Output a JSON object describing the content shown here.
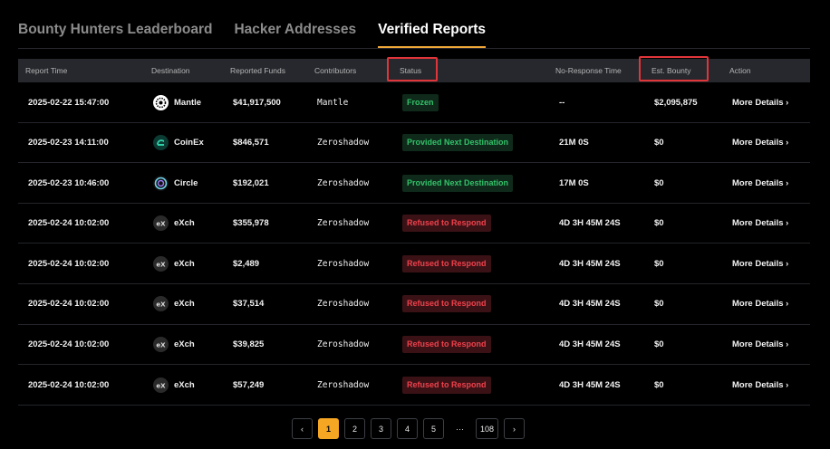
{
  "tabs": [
    "Bounty Hunters Leaderboard",
    "Hacker Addresses",
    "Verified Reports"
  ],
  "headers": {
    "report_time": "Report Time",
    "destination": "Destination",
    "reported_funds": "Reported Funds",
    "contributors": "Contributors",
    "status": "Status",
    "no_response_time": "No-Response Time",
    "est_bounty": "Est. Bounty",
    "action": "Action"
  },
  "highlight_color": "#e0353a",
  "accent_color": "#f5a623",
  "rows": [
    {
      "time": "2025-02-22 15:47:00",
      "dest": "Mantle",
      "dest_icon": "mantle-icon",
      "funds": "$41,917,500",
      "contrib": "Mantle",
      "status": "Frozen",
      "status_color": "green",
      "noresp": "--",
      "bounty": "$2,095,875",
      "action": "More Details ›"
    },
    {
      "time": "2025-02-23 14:11:00",
      "dest": "CoinEx",
      "dest_icon": "coinex-icon",
      "funds": "$846,571",
      "contrib": "Zeroshadow",
      "status": "Provided Next Destination",
      "status_color": "green",
      "noresp": "21M 0S",
      "bounty": "$0",
      "action": "More Details ›"
    },
    {
      "time": "2025-02-23 10:46:00",
      "dest": "Circle",
      "dest_icon": "circle-icon",
      "funds": "$192,021",
      "contrib": "Zeroshadow",
      "status": "Provided Next Destination",
      "status_color": "green",
      "noresp": "17M 0S",
      "bounty": "$0",
      "action": "More Details ›"
    },
    {
      "time": "2025-02-24 10:02:00",
      "dest": "eXch",
      "dest_icon": "exch-icon",
      "funds": "$355,978",
      "contrib": "Zeroshadow",
      "status": "Refused to Respond",
      "status_color": "red",
      "noresp": "4D 3H 45M 24S",
      "bounty": "$0",
      "action": "More Details ›"
    },
    {
      "time": "2025-02-24 10:02:00",
      "dest": "eXch",
      "dest_icon": "exch-icon",
      "funds": "$2,489",
      "contrib": "Zeroshadow",
      "status": "Refused to Respond",
      "status_color": "red",
      "noresp": "4D 3H 45M 24S",
      "bounty": "$0",
      "action": "More Details ›"
    },
    {
      "time": "2025-02-24 10:02:00",
      "dest": "eXch",
      "dest_icon": "exch-icon",
      "funds": "$37,514",
      "contrib": "Zeroshadow",
      "status": "Refused to Respond",
      "status_color": "red",
      "noresp": "4D 3H 45M 24S",
      "bounty": "$0",
      "action": "More Details ›"
    },
    {
      "time": "2025-02-24 10:02:00",
      "dest": "eXch",
      "dest_icon": "exch-icon",
      "funds": "$39,825",
      "contrib": "Zeroshadow",
      "status": "Refused to Respond",
      "status_color": "red",
      "noresp": "4D 3H 45M 24S",
      "bounty": "$0",
      "action": "More Details ›"
    },
    {
      "time": "2025-02-24 10:02:00",
      "dest": "eXch",
      "dest_icon": "exch-icon",
      "funds": "$57,249",
      "contrib": "Zeroshadow",
      "status": "Refused to Respond",
      "status_color": "red",
      "noresp": "4D 3H 45M 24S",
      "bounty": "$0",
      "action": "More Details ›"
    }
  ],
  "pagination": {
    "prev": "‹",
    "pages": [
      "1",
      "2",
      "3",
      "4",
      "5"
    ],
    "ellipsis": "···",
    "last": "108",
    "next": "›",
    "current": "1"
  }
}
